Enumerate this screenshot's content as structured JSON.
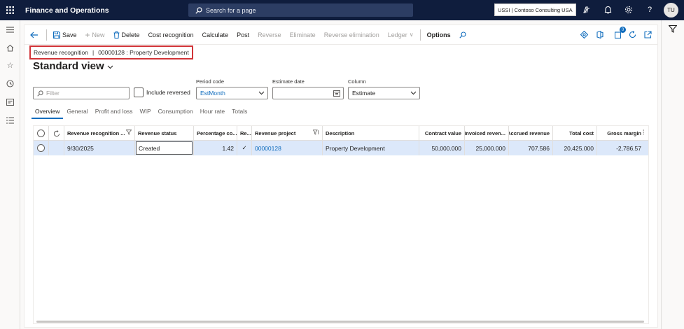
{
  "topbar": {
    "app_title": "Finance and Operations",
    "search_placeholder": "Search for a page",
    "company": "USSI | Contoso Consulting USA",
    "user_initials": "TU"
  },
  "actions": {
    "save": "Save",
    "new": "New",
    "delete": "Delete",
    "cost_recognition": "Cost recognition",
    "calculate": "Calculate",
    "post": "Post",
    "reverse": "Reverse",
    "eliminate": "Eliminate",
    "reverse_elimination": "Reverse elimination",
    "ledger": "Ledger",
    "options": "Options",
    "notifications_count": "0"
  },
  "breadcrumb": {
    "module": "Revenue recognition",
    "separator": "|",
    "record": "00000128 : Property Development"
  },
  "view": {
    "title": "Standard view"
  },
  "filters": {
    "filter_placeholder": "Filter",
    "include_reversed_label": "Include reversed",
    "period_code_label": "Period code",
    "period_code_value": "EstMonth",
    "estimate_date_label": "Estimate date",
    "estimate_date_value": "",
    "column_label": "Column",
    "column_value": "Estimate"
  },
  "tabs": [
    "Overview",
    "General",
    "Profit and loss",
    "WIP",
    "Consumption",
    "Hour rate",
    "Totals"
  ],
  "grid": {
    "columns": {
      "revenue_recognition": "Revenue recognition ...",
      "revenue_status": "Revenue status",
      "percentage": "Percentage co...",
      "re": "Re...",
      "revenue_project": "Revenue project",
      "description": "Description",
      "contract_value": "Contract value",
      "invoiced_revenue": "Invoiced reven...",
      "accrued_revenue": "Accrued revenue",
      "total_cost": "Total cost",
      "gross_margin": "Gross margin"
    },
    "rows": [
      {
        "revenue_recognition": "9/30/2025",
        "revenue_status": "Created",
        "percentage": "1.42",
        "re": "✓",
        "revenue_project": "00000128",
        "description": "Property Development",
        "contract_value": "50,000.000",
        "invoiced_revenue": "25,000.000",
        "accrued_revenue": "707.586",
        "total_cost": "20,425.000",
        "gross_margin": "-2,786.57"
      }
    ]
  },
  "colors": {
    "topbar": "#0f1d3d",
    "accent": "#0f6cbd",
    "highlight_border": "#d13438",
    "selected_row": "#dce8fa"
  }
}
